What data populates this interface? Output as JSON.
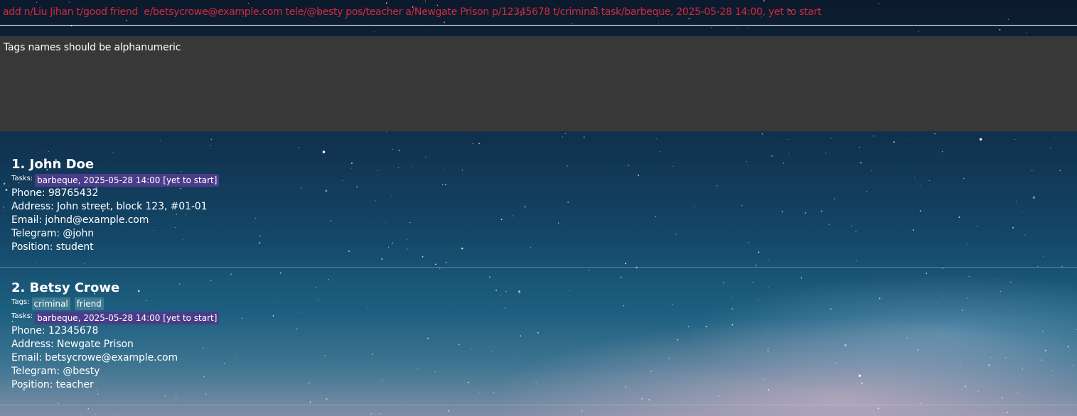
{
  "command_box": {
    "value": "add n/Liu Jihan t/good friend  e/betsycrowe@example.com tele/@besty pos/teacher a/Newgate Prison p/12345678 t/criminal task/barbeque, 2025-05-28 14:00, yet to start"
  },
  "result_display": {
    "message": "Tags names should be alphanumeric"
  },
  "colors": {
    "command_error_text": "#d4283a",
    "result_background": "#383838",
    "tag_background": "#3e7b91",
    "task_background": "#4b3c8a"
  },
  "persons": [
    {
      "name": "1. John Doe",
      "tasks_label": "Tasks:",
      "tasks": [
        "barbeque, 2025-05-28 14:00 [yet to start]"
      ],
      "phone": "Phone: 98765432",
      "address": "Address: John street, block 123, #01-01",
      "email": "Email: johnd@example.com",
      "telegram": "Telegram: @john",
      "position": "Position: student"
    },
    {
      "name": "2. Betsy Crowe",
      "tags_label": "Tags:",
      "tags": [
        "criminal",
        "friend"
      ],
      "tasks_label": "Tasks:",
      "tasks": [
        "barbeque, 2025-05-28 14:00 [yet to start]"
      ],
      "phone": "Phone: 12345678",
      "address": "Address: Newgate Prison",
      "email": "Email: betsycrowe@example.com",
      "telegram": "Telegram: @besty",
      "position": "Position: teacher"
    }
  ]
}
